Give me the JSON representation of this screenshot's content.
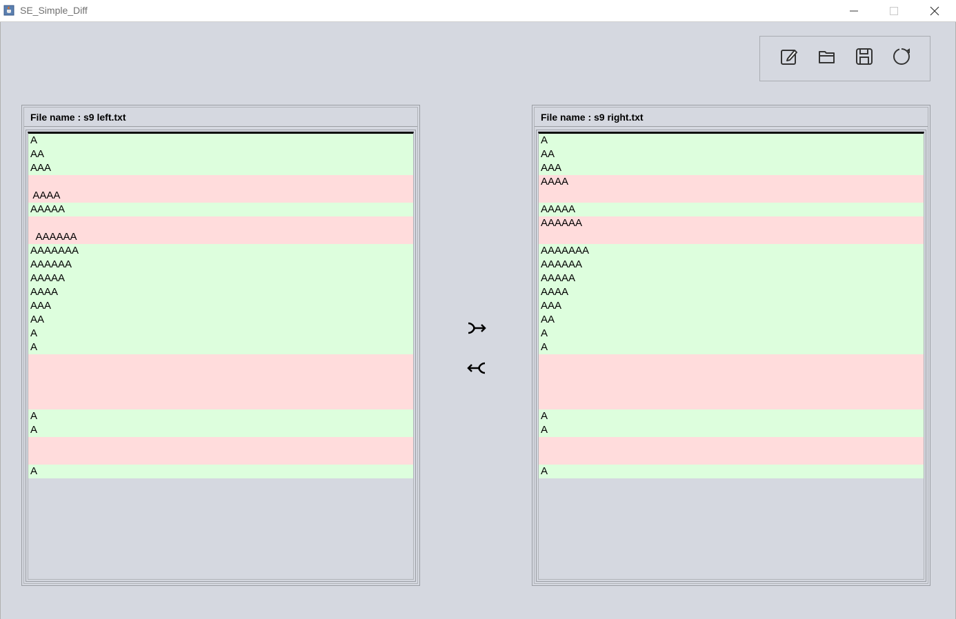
{
  "window": {
    "title": "SE_Simple_Diff"
  },
  "toolbar": {
    "icons": [
      "edit-icon",
      "folder-open-icon",
      "save-icon",
      "refresh-icon"
    ]
  },
  "left": {
    "file_label": "File name : s9 left.txt",
    "lines": [
      {
        "text": "A",
        "type": "same"
      },
      {
        "text": "AA",
        "type": "same"
      },
      {
        "text": "AAA",
        "type": "same"
      },
      {
        "text": "",
        "type": "diff"
      },
      {
        "text": " AAAA",
        "type": "diff"
      },
      {
        "text": "AAAAA",
        "type": "same"
      },
      {
        "text": "",
        "type": "diff"
      },
      {
        "text": "  AAAAAA",
        "type": "diff"
      },
      {
        "text": "AAAAAAA",
        "type": "same"
      },
      {
        "text": "AAAAAA",
        "type": "same"
      },
      {
        "text": "AAAAA",
        "type": "same"
      },
      {
        "text": "AAAA",
        "type": "same"
      },
      {
        "text": "AAA",
        "type": "same"
      },
      {
        "text": "AA",
        "type": "same"
      },
      {
        "text": "A",
        "type": "same"
      },
      {
        "text": "A",
        "type": "same"
      },
      {
        "text": "",
        "type": "diff"
      },
      {
        "text": "",
        "type": "diff"
      },
      {
        "text": "",
        "type": "diff"
      },
      {
        "text": "",
        "type": "diff"
      },
      {
        "text": "A",
        "type": "same"
      },
      {
        "text": "A",
        "type": "same"
      },
      {
        "text": "",
        "type": "diff"
      },
      {
        "text": "",
        "type": "diff"
      },
      {
        "text": "A",
        "type": "same"
      }
    ]
  },
  "right": {
    "file_label": "File name : s9 right.txt",
    "lines": [
      {
        "text": "A",
        "type": "same"
      },
      {
        "text": "AA",
        "type": "same"
      },
      {
        "text": "AAA",
        "type": "same"
      },
      {
        "text": "AAAA",
        "type": "diff"
      },
      {
        "text": "",
        "type": "diff"
      },
      {
        "text": "AAAAA",
        "type": "same"
      },
      {
        "text": "AAAAAA",
        "type": "diff"
      },
      {
        "text": "",
        "type": "diff"
      },
      {
        "text": "AAAAAAA",
        "type": "same"
      },
      {
        "text": "AAAAAA",
        "type": "same"
      },
      {
        "text": "AAAAA",
        "type": "same"
      },
      {
        "text": "AAAA",
        "type": "same"
      },
      {
        "text": "AAA",
        "type": "same"
      },
      {
        "text": "AA",
        "type": "same"
      },
      {
        "text": "A",
        "type": "same"
      },
      {
        "text": "A",
        "type": "same"
      },
      {
        "text": "",
        "type": "diff"
      },
      {
        "text": "",
        "type": "diff"
      },
      {
        "text": "",
        "type": "diff"
      },
      {
        "text": "",
        "type": "diff"
      },
      {
        "text": "A",
        "type": "same"
      },
      {
        "text": "A",
        "type": "same"
      },
      {
        "text": "",
        "type": "diff"
      },
      {
        "text": "",
        "type": "diff"
      },
      {
        "text": "A",
        "type": "same"
      }
    ]
  },
  "merge": {
    "icons": [
      "merge-to-right-icon",
      "merge-to-left-icon"
    ]
  },
  "colors": {
    "same_line": "#ddfedd",
    "diff_line": "#ffdcdc",
    "background": "#d5d8e0"
  }
}
